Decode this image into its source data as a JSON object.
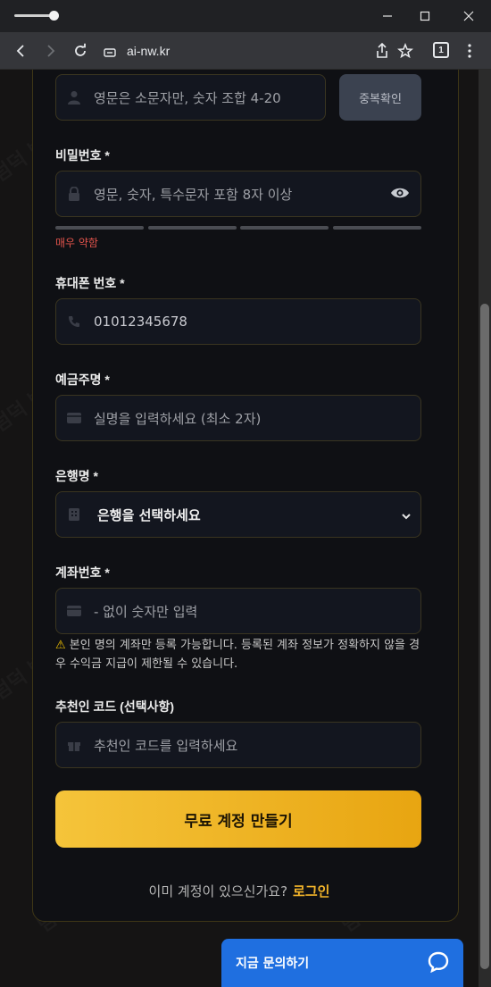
{
  "browser": {
    "url": "ai-nw.kr",
    "tab_count": "1"
  },
  "form": {
    "username": {
      "placeholder": "영문은 소문자만, 숫자 조합 4-20",
      "check_button": "중복확인"
    },
    "password": {
      "label": "비밀번호 *",
      "placeholder": "영문, 숫자, 특수문자 포함 8자 이상",
      "strength_text": "매우 약함",
      "strength_level": 0
    },
    "phone": {
      "label": "휴대폰 번호 *",
      "value": "01012345678"
    },
    "account_holder": {
      "label": "예금주명 *",
      "placeholder": "실명을 입력하세요 (최소 2자)"
    },
    "bank": {
      "label": "은행명 *",
      "selected": "은행을 선택하세요"
    },
    "account_number": {
      "label": "계좌번호 *",
      "placeholder": "- 없이 숫자만 입력",
      "notice_icon": "⚠",
      "notice": "본인 명의 계좌만 등록 가능합니다. 등록된 계좌 정보가 정확하지 않을 경우 수익금 지급이 제한될 수 있습니다."
    },
    "referral": {
      "label": "추천인 코드 (선택사항)",
      "placeholder": "추천인 코드를 입력하세요"
    },
    "submit_label": "무료 계정 만들기",
    "login_prompt": "이미 계정이 있으신가요?",
    "login_link": "로그인"
  },
  "chat": {
    "label": "지금 문의하기"
  },
  "watermark_text": "덤덕 범툴사무소",
  "colors": {
    "accent": "#f2b42a",
    "chat": "#1f6fe0",
    "danger": "#e0534b"
  }
}
